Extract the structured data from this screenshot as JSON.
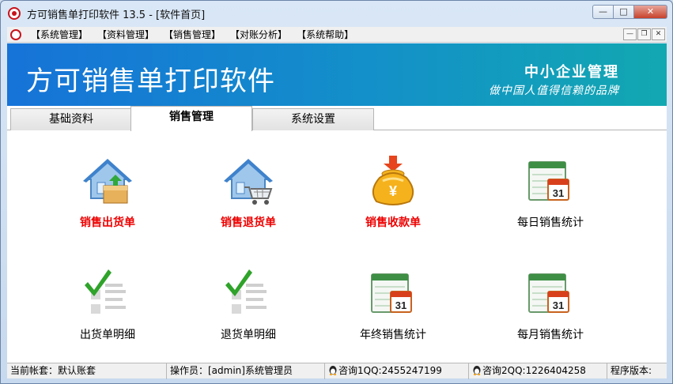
{
  "window": {
    "title": "方可销售单打印软件 13.5 - [软件首页]",
    "controls": {
      "minimize": "—",
      "maximize": "□",
      "close": "✕"
    }
  },
  "menubar": {
    "items": [
      "【系统管理】",
      "【资料管理】",
      "【销售管理】",
      "【对账分析】",
      "【系统帮助】"
    ],
    "mdi_controls": {
      "minimize": "—",
      "restore": "❐",
      "close": "✕"
    }
  },
  "banner": {
    "title": "方可销售单打印软件",
    "tagline1": "中小企业管理",
    "tagline2": "做中国人值得信赖的品牌"
  },
  "tabs": [
    {
      "label": "基础资料",
      "active": false
    },
    {
      "label": "销售管理",
      "active": true
    },
    {
      "label": "系统设置",
      "active": false
    }
  ],
  "tiles": [
    {
      "label": "销售出货单",
      "icon": "house-box-icon",
      "highlight": true
    },
    {
      "label": "销售退货单",
      "icon": "house-cart-icon",
      "highlight": true
    },
    {
      "label": "销售收款单",
      "icon": "money-bag-icon",
      "highlight": true
    },
    {
      "label": "每日销售统计",
      "icon": "calendar-icon",
      "highlight": false
    },
    {
      "label": "出货单明细",
      "icon": "checklist-icon",
      "highlight": false
    },
    {
      "label": "退货单明细",
      "icon": "checklist-icon",
      "highlight": false
    },
    {
      "label": "年终销售统计",
      "icon": "calendar-icon",
      "highlight": false
    },
    {
      "label": "每月销售统计",
      "icon": "calendar-icon",
      "highlight": false
    }
  ],
  "calendar_day": "31",
  "money_symbol": "¥",
  "statusbar": {
    "account": "当前帐套：默认账套",
    "operator": "操作员：[admin]系统管理员",
    "qq1": "咨询1QQ:2455247199",
    "qq2": "咨询2QQ:1226404258",
    "version": "程序版本:"
  },
  "colors": {
    "banner_start": "#1673d8",
    "banner_end": "#12a8b1",
    "highlight_label": "#e00000",
    "calendar_red": "#d8401c",
    "check_green": "#2fa32a"
  }
}
